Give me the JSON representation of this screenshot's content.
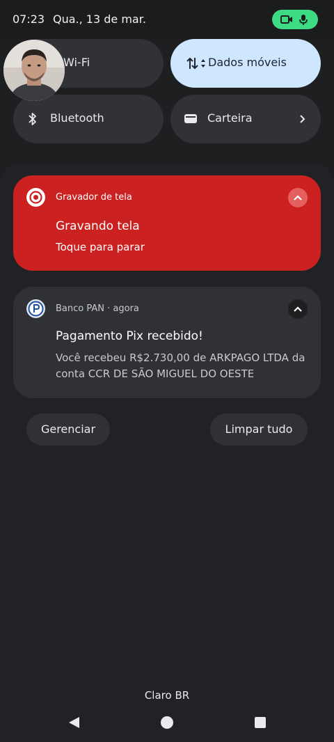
{
  "status_bar": {
    "time": "07:23",
    "date": "Qua., 13 de mar."
  },
  "quick_settings": {
    "tiles": [
      {
        "label": "Wi-Fi",
        "active": false
      },
      {
        "label": "Dados móveis",
        "active": true
      },
      {
        "label": "Bluetooth",
        "active": false
      },
      {
        "label": "Carteira",
        "active": false
      }
    ]
  },
  "notifications": [
    {
      "app": "Gravador de tela",
      "title": "Gravando tela",
      "text": "Toque para parar",
      "accent": "#cc2121"
    },
    {
      "app": "Banco PAN",
      "time": "agora",
      "title": "Pagamento Pix recebido!",
      "text": "Você recebeu R$2.730,00 de ARKPAGO LTDA da conta CCR DE SÃO MIGUEL DO OESTE"
    }
  ],
  "actions": {
    "manage": "Gerenciar",
    "clear_all": "Limpar tudo"
  },
  "carrier": "Claro BR",
  "colors": {
    "recording_indicator": "#3ddc84",
    "active_tile": "#cfe6ff"
  }
}
